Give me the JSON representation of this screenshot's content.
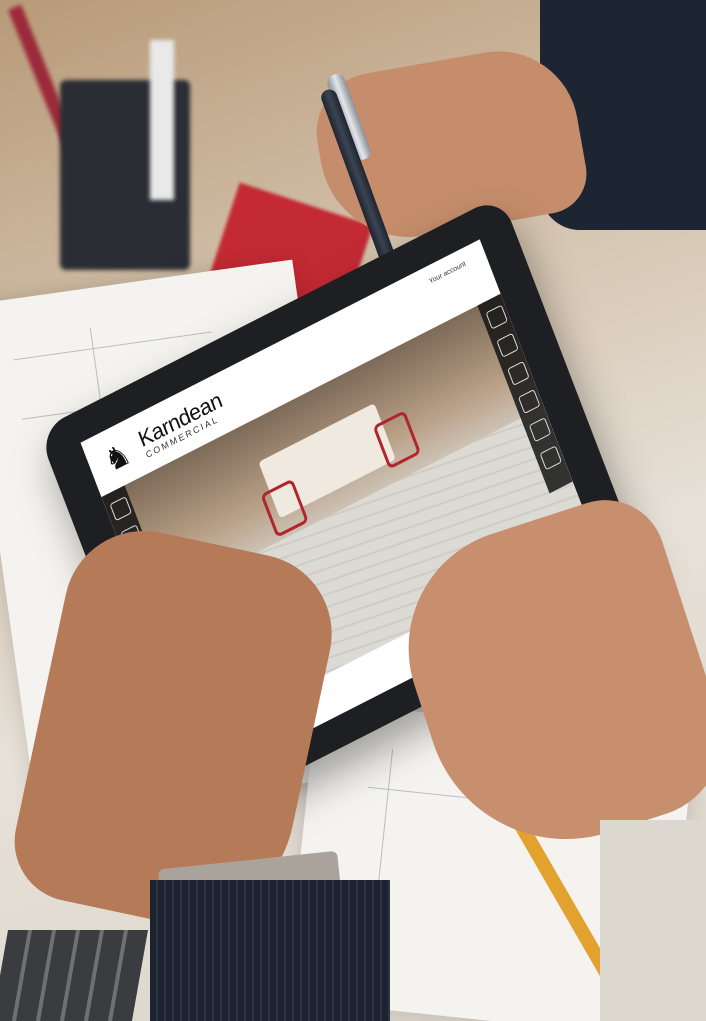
{
  "photo": {
    "description_tags": [
      "hands",
      "tablet",
      "stylus-pen",
      "desk",
      "blueprints"
    ]
  },
  "tablet_ui": {
    "brand": {
      "name": "Karndean",
      "sub": "COMMERCIAL",
      "icon": "horse-logo-icon"
    },
    "account_label": "Your account",
    "left_toolbar_icons": [
      "floor-icon",
      "pattern-icon",
      "room-icon",
      "rotate-icon",
      "grid-icon",
      "share-icon",
      "save-icon",
      "more-icon"
    ],
    "right_toolbar_icons": [
      "zoom-icon",
      "photo-icon",
      "compare-icon",
      "light-icon",
      "print-icon",
      "bag-icon"
    ]
  },
  "colors": {
    "tablet_frame": "#1e1f22",
    "screen_bg": "#ffffff",
    "toolbar_bg": "#141414",
    "chair_red": "#b1262d"
  }
}
